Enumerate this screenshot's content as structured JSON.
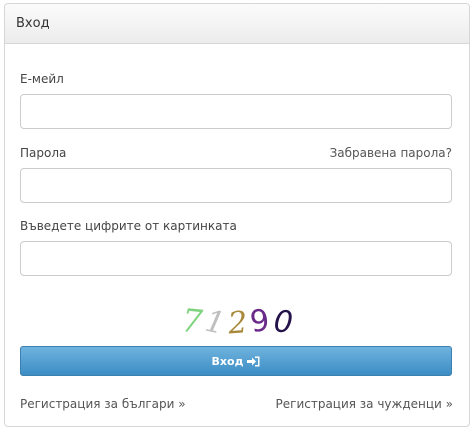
{
  "panel": {
    "title": "Вход"
  },
  "form": {
    "email_label": "Е-мейл",
    "email_value": "",
    "password_label": "Парола",
    "forgot_password_link": "Забравена парола?",
    "password_value": "",
    "captcha_label": "Въведете цифрите от картинката",
    "captcha_value": "",
    "captcha_digits": [
      "7",
      "1",
      "2",
      "9",
      "0"
    ],
    "captcha_colors": [
      "#7fd37f",
      "#bfbfbf",
      "#a8893a",
      "#6a2a8a",
      "#24124a"
    ],
    "submit_label": "Вход",
    "submit_icon": "sign-in-icon"
  },
  "footer": {
    "register_bulgarians": "Регистрация за българи »",
    "register_foreigners": "Регистрация за чужденци »"
  }
}
